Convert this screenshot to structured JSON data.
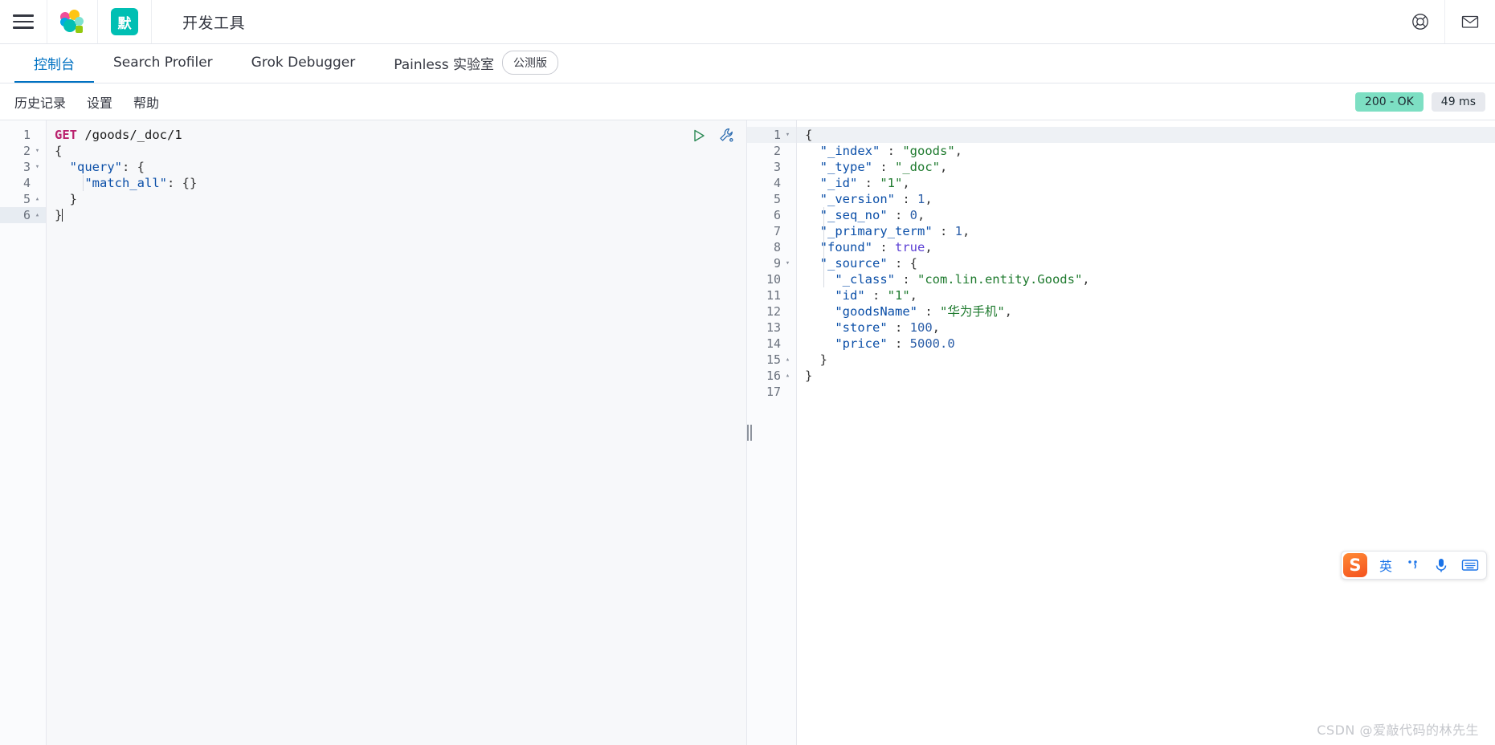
{
  "topbar": {
    "menu_icon": "hamburger-icon",
    "logo_icon": "elastic-logo-icon",
    "space_badge": "默",
    "app_title": "开发工具",
    "help_icon": "life-ring-icon",
    "mail_icon": "envelope-icon"
  },
  "apptabs": [
    {
      "label": "控制台",
      "active": true,
      "badge": ""
    },
    {
      "label": "Search Profiler",
      "active": false,
      "badge": ""
    },
    {
      "label": "Grok Debugger",
      "active": false,
      "badge": ""
    },
    {
      "label": "Painless 实验室",
      "active": false,
      "badge": "公测版"
    }
  ],
  "subbar": {
    "items": [
      "历史记录",
      "设置",
      "帮助"
    ],
    "status_code": "200 - OK",
    "status_time": "49 ms",
    "status_ok_color": "#7ddfc3",
    "status_time_color": "#e7e9ee"
  },
  "request_editor": {
    "actions": {
      "play_icon": "play-triangle-icon",
      "wrench_icon": "wrench-icon"
    },
    "lines": [
      {
        "n": "1",
        "fold": "",
        "highlight": false,
        "tokens": [
          {
            "t": "GET",
            "c": "k-method"
          },
          {
            "t": " /goods/_doc/1",
            "c": "k-url"
          }
        ]
      },
      {
        "n": "2",
        "fold": "▾",
        "highlight": false,
        "tokens": [
          {
            "t": "{",
            "c": "k-punct"
          }
        ]
      },
      {
        "n": "3",
        "fold": "▾",
        "highlight": false,
        "tokens": [
          {
            "t": "  ",
            "c": "k-punct"
          },
          {
            "t": "\"query\"",
            "c": "k-key"
          },
          {
            "t": ": {",
            "c": "k-punct"
          }
        ]
      },
      {
        "n": "4",
        "fold": "",
        "highlight": false,
        "tokens": [
          {
            "t": "    ",
            "c": "k-punct"
          },
          {
            "t": "\"match_all\"",
            "c": "k-key"
          },
          {
            "t": ": {}",
            "c": "k-punct"
          }
        ]
      },
      {
        "n": "5",
        "fold": "▴",
        "highlight": false,
        "tokens": [
          {
            "t": "  }",
            "c": "k-punct"
          }
        ]
      },
      {
        "n": "6",
        "fold": "▴",
        "highlight": true,
        "tokens": [
          {
            "t": "}",
            "c": "k-punct"
          }
        ],
        "caret": true
      }
    ]
  },
  "response_editor": {
    "lines": [
      {
        "n": "1",
        "fold": "▾",
        "highlight": true,
        "tokens": [
          {
            "t": "{",
            "c": "k-punct"
          }
        ]
      },
      {
        "n": "2",
        "fold": "",
        "highlight": false,
        "tokens": [
          {
            "t": "  ",
            "c": "k-punct"
          },
          {
            "t": "\"_index\"",
            "c": "k-key"
          },
          {
            "t": " : ",
            "c": "k-punct"
          },
          {
            "t": "\"goods\"",
            "c": "k-str"
          },
          {
            "t": ",",
            "c": "k-punct"
          }
        ]
      },
      {
        "n": "3",
        "fold": "",
        "highlight": false,
        "tokens": [
          {
            "t": "  ",
            "c": "k-punct"
          },
          {
            "t": "\"_type\"",
            "c": "k-key"
          },
          {
            "t": " : ",
            "c": "k-punct"
          },
          {
            "t": "\"_doc\"",
            "c": "k-str"
          },
          {
            "t": ",",
            "c": "k-punct"
          }
        ]
      },
      {
        "n": "4",
        "fold": "",
        "highlight": false,
        "tokens": [
          {
            "t": "  ",
            "c": "k-punct"
          },
          {
            "t": "\"_id\"",
            "c": "k-key"
          },
          {
            "t": " : ",
            "c": "k-punct"
          },
          {
            "t": "\"1\"",
            "c": "k-str"
          },
          {
            "t": ",",
            "c": "k-punct"
          }
        ]
      },
      {
        "n": "5",
        "fold": "",
        "highlight": false,
        "tokens": [
          {
            "t": "  ",
            "c": "k-punct"
          },
          {
            "t": "\"_version\"",
            "c": "k-key"
          },
          {
            "t": " : ",
            "c": "k-punct"
          },
          {
            "t": "1",
            "c": "k-num"
          },
          {
            "t": ",",
            "c": "k-punct"
          }
        ]
      },
      {
        "n": "6",
        "fold": "",
        "highlight": false,
        "tokens": [
          {
            "t": "  ",
            "c": "k-punct"
          },
          {
            "t": "\"_seq_no\"",
            "c": "k-key"
          },
          {
            "t": " : ",
            "c": "k-punct"
          },
          {
            "t": "0",
            "c": "k-num"
          },
          {
            "t": ",",
            "c": "k-punct"
          }
        ]
      },
      {
        "n": "7",
        "fold": "",
        "highlight": false,
        "tokens": [
          {
            "t": "  ",
            "c": "k-punct"
          },
          {
            "t": "\"_primary_term\"",
            "c": "k-key"
          },
          {
            "t": " : ",
            "c": "k-punct"
          },
          {
            "t": "1",
            "c": "k-num"
          },
          {
            "t": ",",
            "c": "k-punct"
          }
        ]
      },
      {
        "n": "8",
        "fold": "",
        "highlight": false,
        "tokens": [
          {
            "t": "  ",
            "c": "k-punct"
          },
          {
            "t": "\"found\"",
            "c": "k-key"
          },
          {
            "t": " : ",
            "c": "k-punct"
          },
          {
            "t": "true",
            "c": "k-bool"
          },
          {
            "t": ",",
            "c": "k-punct"
          }
        ]
      },
      {
        "n": "9",
        "fold": "▾",
        "highlight": false,
        "tokens": [
          {
            "t": "  ",
            "c": "k-punct"
          },
          {
            "t": "\"_source\"",
            "c": "k-key"
          },
          {
            "t": " : {",
            "c": "k-punct"
          }
        ]
      },
      {
        "n": "10",
        "fold": "",
        "highlight": false,
        "tokens": [
          {
            "t": "    ",
            "c": "k-punct"
          },
          {
            "t": "\"_class\"",
            "c": "k-key"
          },
          {
            "t": " : ",
            "c": "k-punct"
          },
          {
            "t": "\"com.lin.entity.Goods\"",
            "c": "k-str"
          },
          {
            "t": ",",
            "c": "k-punct"
          }
        ]
      },
      {
        "n": "11",
        "fold": "",
        "highlight": false,
        "tokens": [
          {
            "t": "    ",
            "c": "k-punct"
          },
          {
            "t": "\"id\"",
            "c": "k-key"
          },
          {
            "t": " : ",
            "c": "k-punct"
          },
          {
            "t": "\"1\"",
            "c": "k-str"
          },
          {
            "t": ",",
            "c": "k-punct"
          }
        ]
      },
      {
        "n": "12",
        "fold": "",
        "highlight": false,
        "tokens": [
          {
            "t": "    ",
            "c": "k-punct"
          },
          {
            "t": "\"goodsName\"",
            "c": "k-key"
          },
          {
            "t": " : ",
            "c": "k-punct"
          },
          {
            "t": "\"华为手机\"",
            "c": "k-str"
          },
          {
            "t": ",",
            "c": "k-punct"
          }
        ]
      },
      {
        "n": "13",
        "fold": "",
        "highlight": false,
        "tokens": [
          {
            "t": "    ",
            "c": "k-punct"
          },
          {
            "t": "\"store\"",
            "c": "k-key"
          },
          {
            "t": " : ",
            "c": "k-punct"
          },
          {
            "t": "100",
            "c": "k-num"
          },
          {
            "t": ",",
            "c": "k-punct"
          }
        ]
      },
      {
        "n": "14",
        "fold": "",
        "highlight": false,
        "tokens": [
          {
            "t": "    ",
            "c": "k-punct"
          },
          {
            "t": "\"price\"",
            "c": "k-key"
          },
          {
            "t": " : ",
            "c": "k-punct"
          },
          {
            "t": "5000.0",
            "c": "k-num"
          }
        ]
      },
      {
        "n": "15",
        "fold": "▴",
        "highlight": false,
        "tokens": [
          {
            "t": "  }",
            "c": "k-punct"
          }
        ]
      },
      {
        "n": "16",
        "fold": "▴",
        "highlight": false,
        "tokens": [
          {
            "t": "}",
            "c": "k-punct"
          }
        ]
      },
      {
        "n": "17",
        "fold": "",
        "highlight": false,
        "tokens": []
      }
    ]
  },
  "ime": {
    "logo": "S",
    "mode": "英",
    "punct_icon": "punctuation-icon",
    "mic_icon": "microphone-icon",
    "keyboard_icon": "keyboard-icon"
  },
  "watermark": "CSDN @爱敲代码的林先生"
}
